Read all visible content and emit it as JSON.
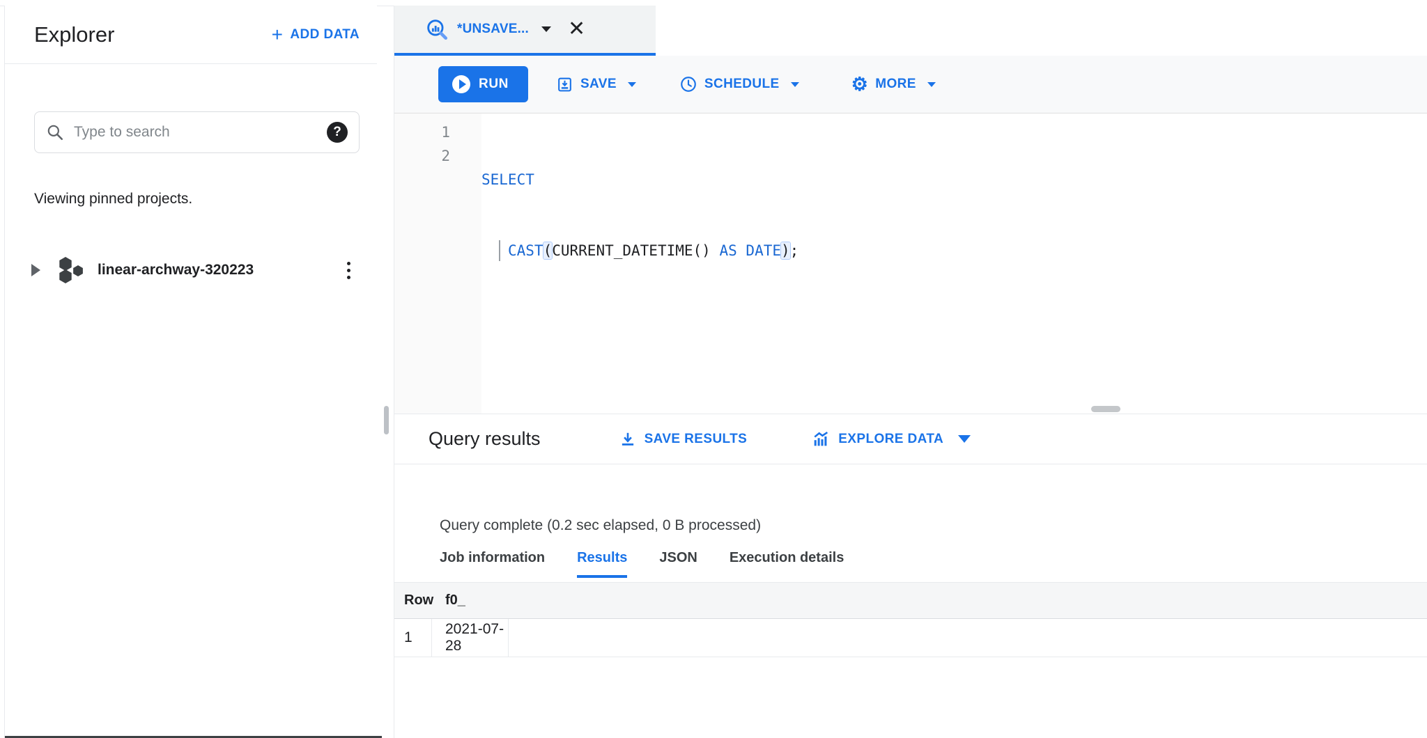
{
  "colors": {
    "accent": "#1a73e8",
    "keyword_blue": "#1967d2",
    "text_dark": "#202124",
    "text_gray": "#5f6368",
    "toolbar_bg": "#f8f9fa",
    "tab_bg": "#f1f3f4",
    "bracket_highlight": "#e8f0fe"
  },
  "sidebar": {
    "title": "Explorer",
    "add_data_label": "ADD DATA",
    "search_placeholder": "Type to search",
    "viewing_text": "Viewing pinned projects.",
    "project": {
      "name": "linear-archway-320223"
    }
  },
  "editor": {
    "tab_label": "*UNSAVE...",
    "toolbar": {
      "run_label": "RUN",
      "save_label": "SAVE",
      "schedule_label": "SCHEDULE",
      "more_label": "MORE"
    },
    "code": {
      "line_numbers": [
        "1",
        "2"
      ],
      "lines": [
        {
          "tokens": [
            {
              "t": "SELECT"
            }
          ]
        },
        {
          "tokens": [
            {
              "t": "CAST"
            },
            {
              "t": "("
            },
            {
              "t": "CURRENT_DATETIME()"
            },
            {
              "t": " "
            },
            {
              "t": "AS"
            },
            {
              "t": " "
            },
            {
              "t": "DATE"
            },
            {
              "t": ")"
            },
            {
              "t": ";"
            }
          ]
        }
      ]
    }
  },
  "results": {
    "title": "Query results",
    "save_results_label": "SAVE RESULTS",
    "explore_data_label": "EXPLORE DATA",
    "status": "Query complete (0.2 sec elapsed, 0 B processed)",
    "tabs": [
      {
        "label": "Job information"
      },
      {
        "label": "Results"
      },
      {
        "label": "JSON"
      },
      {
        "label": "Execution details"
      }
    ],
    "table": {
      "headers": [
        "Row",
        "f0_"
      ],
      "rows": [
        [
          "1",
          "2021-07-28"
        ]
      ]
    }
  },
  "icons": {
    "plus": "+",
    "question": "?",
    "close": "✕",
    "gear": "⚙"
  }
}
